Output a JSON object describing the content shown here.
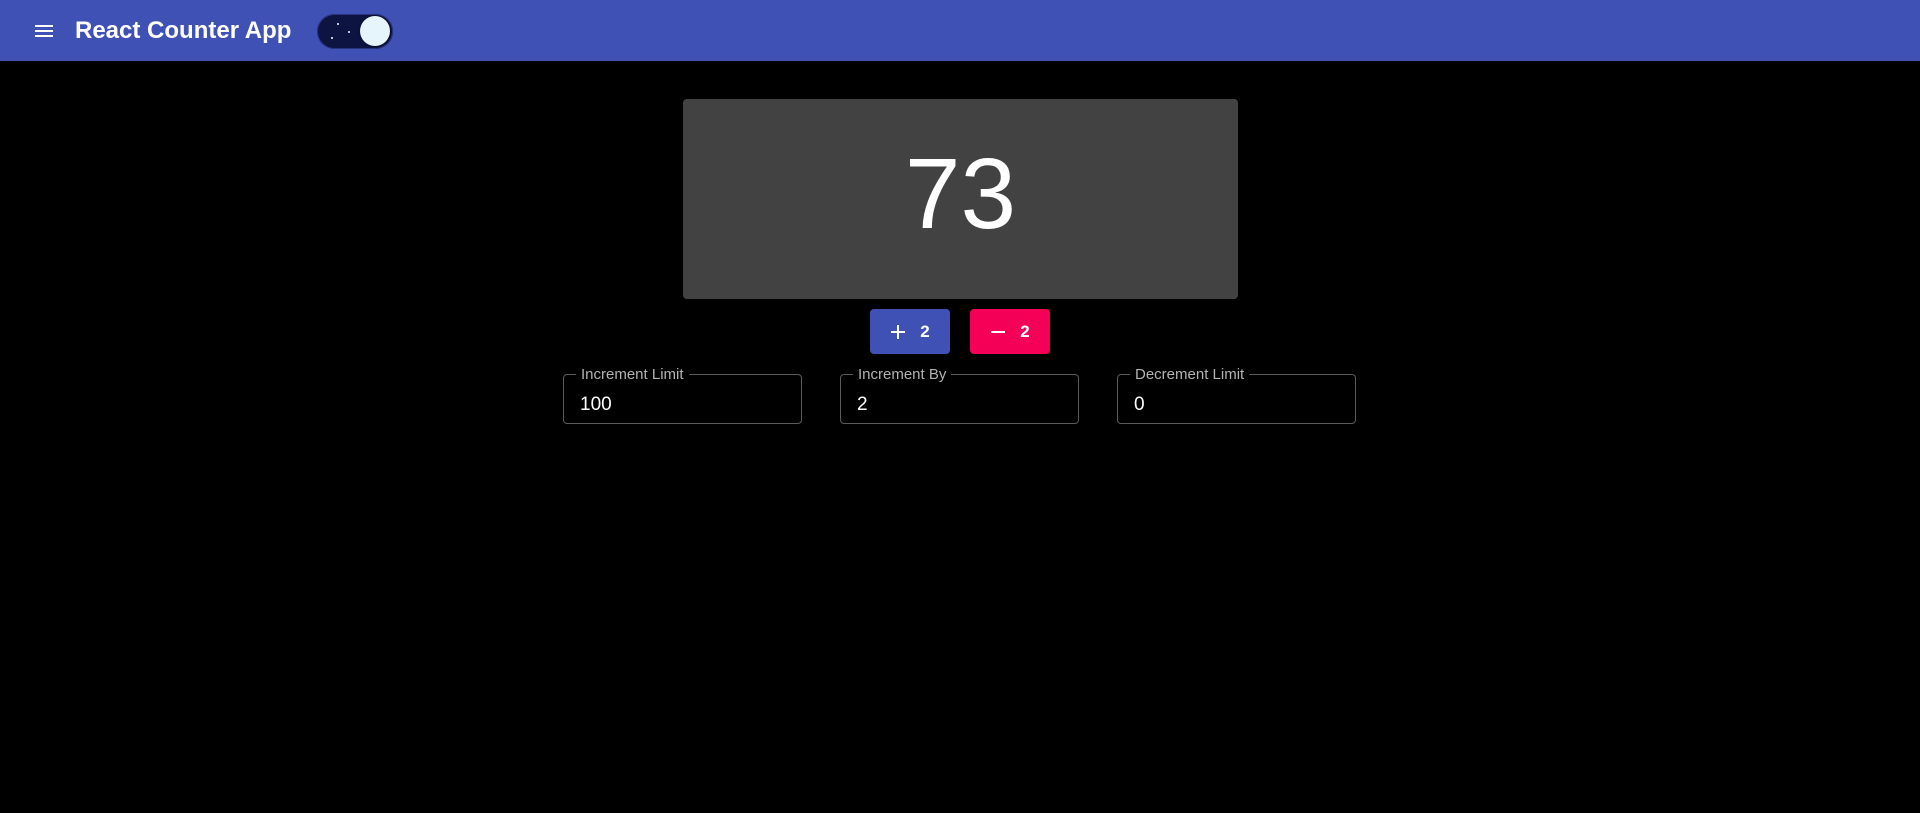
{
  "app": {
    "title": "React Counter App",
    "colors": {
      "appbar": "#3f51b5",
      "background": "#000000",
      "card": "#424242",
      "increment_button": "#3f51b5",
      "decrement_button": "#f50057"
    },
    "menu_icon": "hamburger-menu-icon",
    "theme_toggle": {
      "mode": "dark",
      "checked": true,
      "icon": "night-sky-icon"
    }
  },
  "counter": {
    "value": "73"
  },
  "buttons": {
    "increment": {
      "icon": "plus-icon",
      "label": "2"
    },
    "decrement": {
      "icon": "minus-icon",
      "label": "2"
    }
  },
  "fields": {
    "increment_limit": {
      "label": "Increment Limit",
      "value": "100"
    },
    "increment_by": {
      "label": "Increment By",
      "value": "2"
    },
    "decrement_limit": {
      "label": "Decrement Limit",
      "value": "0"
    }
  }
}
